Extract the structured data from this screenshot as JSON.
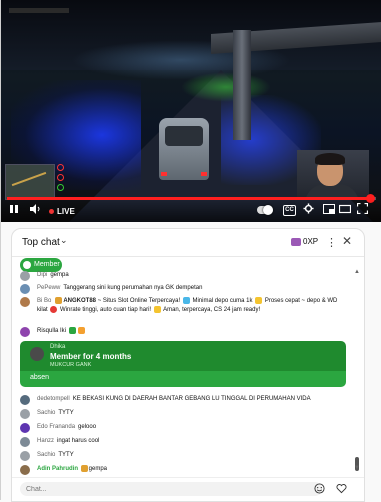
{
  "player": {
    "live_label": "LIVE",
    "progress_fraction": 0.985,
    "cc_label": "CC",
    "hud_right_lines": [
      "",
      ""
    ]
  },
  "chat": {
    "title": "Top chat",
    "xp_label": "0XP",
    "member_chip": "Member",
    "input_placeholder": "Chat...",
    "messages": [
      {
        "author": "Dipi",
        "text": "gempa",
        "avatar_color": "#9aa0a6"
      },
      {
        "author": "PePeww",
        "text": "Tanggerang sini kung perumahan nya GK dempetan",
        "avatar_color": "#6b8fb3"
      },
      {
        "author": "Bi Bo",
        "brand": "ANGKOT88",
        "text_a": "~ Situs Slot Online Terpercaya!",
        "text_b": "Minimal depo cuma 1k",
        "text_c": "Proses cepat ~ depo & WD kilat",
        "text_d": "Winrate tinggi, auto cuan tiap hari!",
        "text_e": "Aman, terpercaya, CS 24 jam ready!",
        "avatar_color": "#b07a4a"
      },
      {
        "author": "Risqulla Iki",
        "text": "",
        "avatar_color": "#8e44ad"
      },
      {
        "author": "dedetompell",
        "text": "KE BEKASI KUNG DI DAERAH BANTAR GEBANG LU TINGGAL DI PERUMAHAN VIDA",
        "avatar_color": "#556b7d"
      },
      {
        "author": "Sachio",
        "text": "TYTY",
        "avatar_color": "#9aa0a6"
      },
      {
        "author": "Edo Frananda",
        "text": "gelooo",
        "avatar_color": "#5e35b1"
      },
      {
        "author": "Hanzz",
        "text": "ingat harus cool",
        "avatar_color": "#7d8a96"
      },
      {
        "author": "Sachio",
        "text": "TYTY",
        "avatar_color": "#9aa0a6"
      },
      {
        "author": "Adin Pahrudin",
        "text": "gempa",
        "avatar_color": "#8a6d4b"
      }
    ],
    "gift": {
      "name": "Dhika",
      "title": "Member for 4 months",
      "sub": "MUKCUR GANK",
      "message": "absen"
    }
  }
}
